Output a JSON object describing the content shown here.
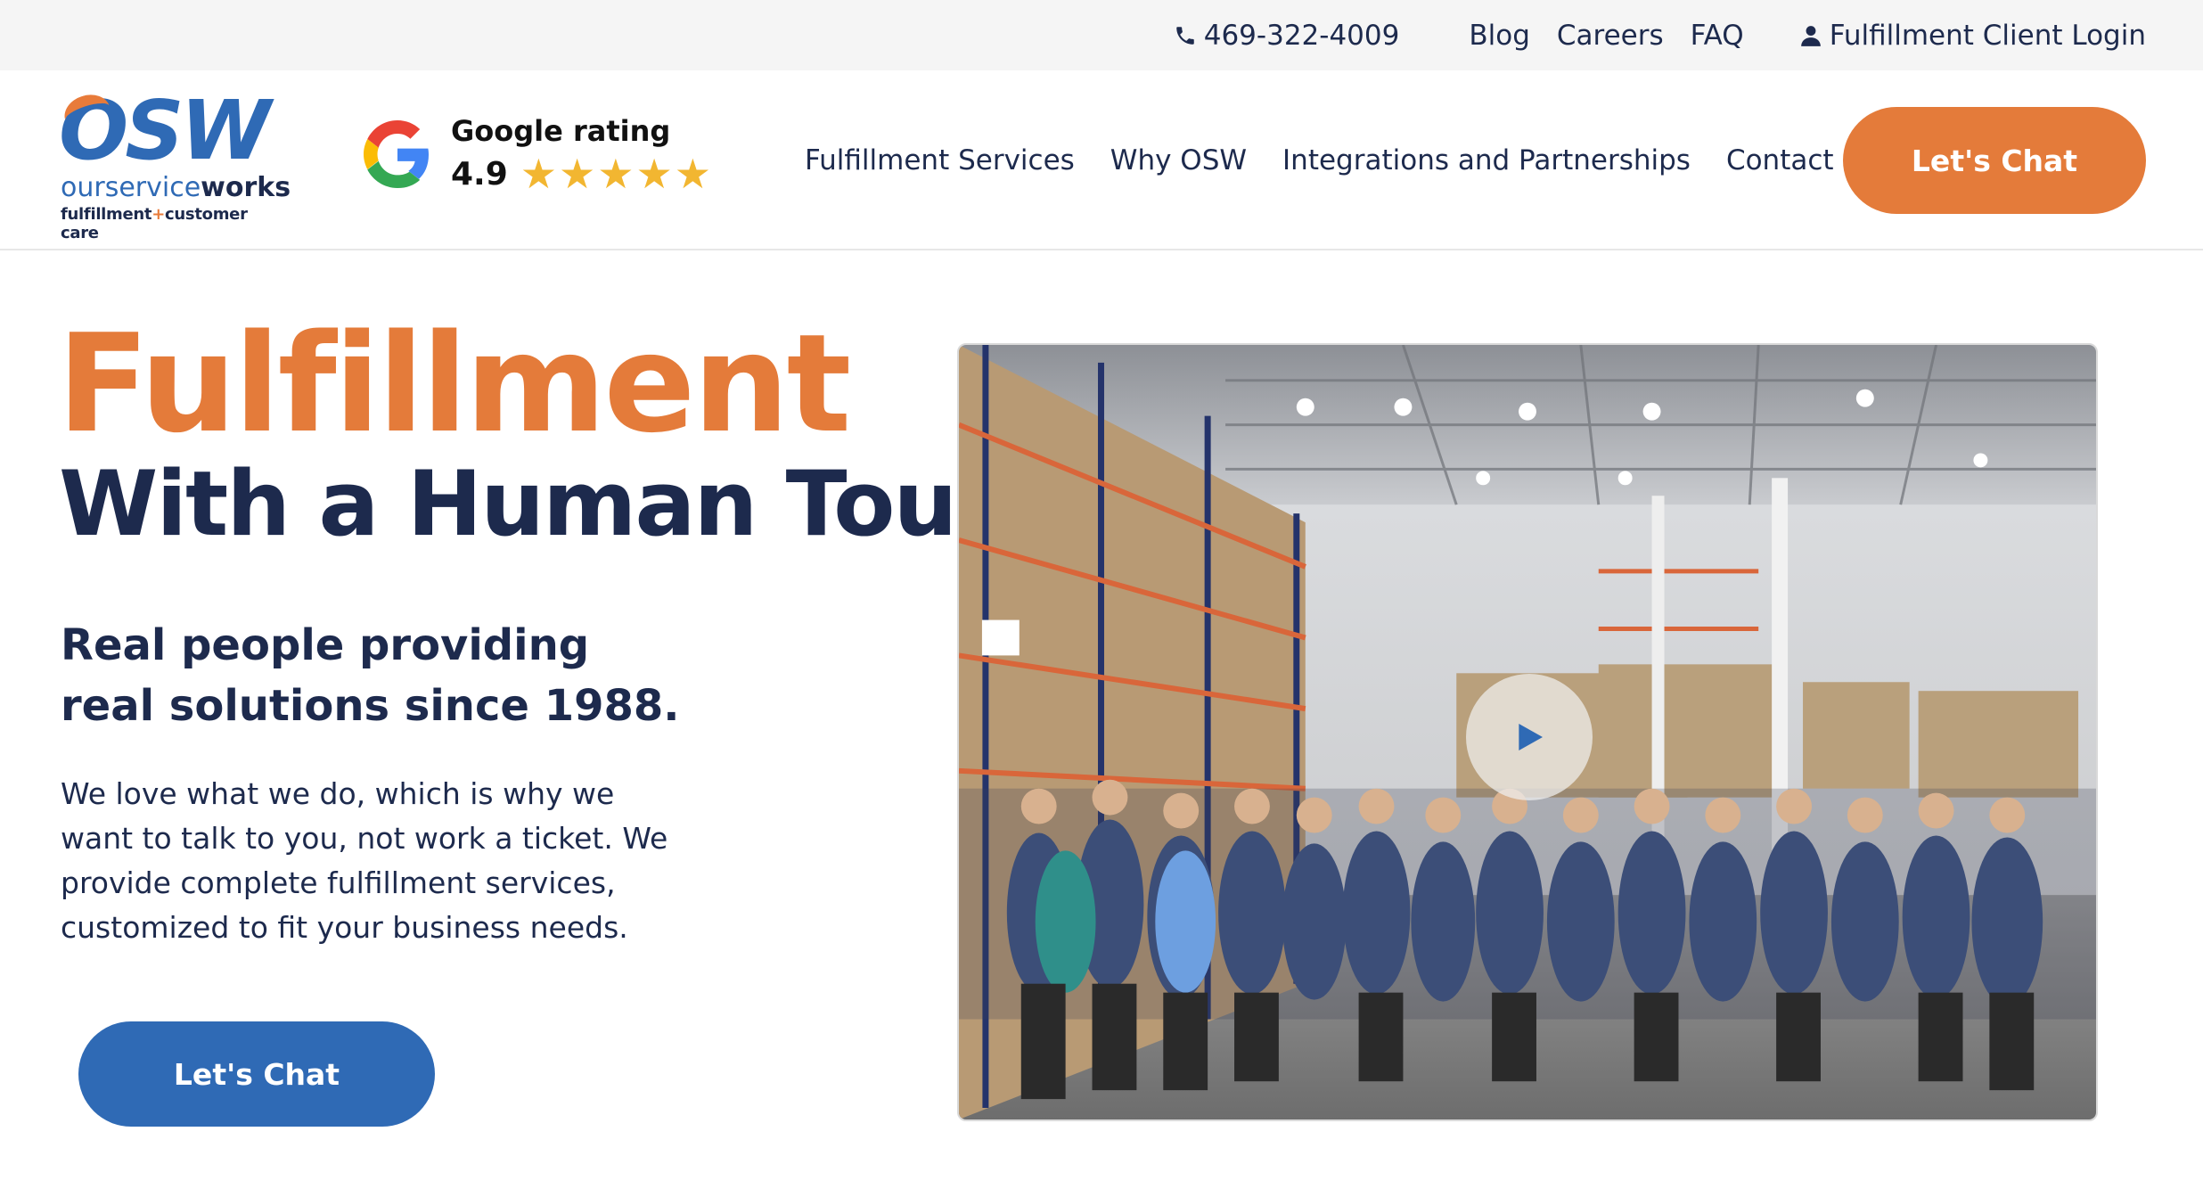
{
  "topbar": {
    "phone": "469-322-4009",
    "links": [
      "Blog",
      "Careers",
      "FAQ"
    ],
    "login": "Fulfillment Client Login"
  },
  "header": {
    "logo": {
      "mark": "OSW",
      "word_a": "ourservice",
      "word_b": "works",
      "tag_a": "fulfillment",
      "tag_plus": "+",
      "tag_b": "customer care"
    },
    "rating": {
      "title": "Google rating",
      "score": "4.9",
      "stars": 5
    },
    "nav": [
      "Fulfillment Services",
      "Why OSW",
      "Integrations and Partnerships",
      "Contact Us"
    ],
    "cta": "Let's Chat"
  },
  "hero": {
    "title_1": "Fulfillment",
    "title_2": "With a Human Touch",
    "subtitle": "Real people providing real solutions since 1988.",
    "body": "We love what we do, which is why we want to talk to you, not work a ticket. We provide complete fulfillment services, customized to fit your business needs.",
    "cta": "Let's Chat"
  },
  "colors": {
    "orange": "#e47b3a",
    "blue": "#2f6ab5",
    "navy": "#1d2a4d",
    "star": "#f2b631"
  }
}
